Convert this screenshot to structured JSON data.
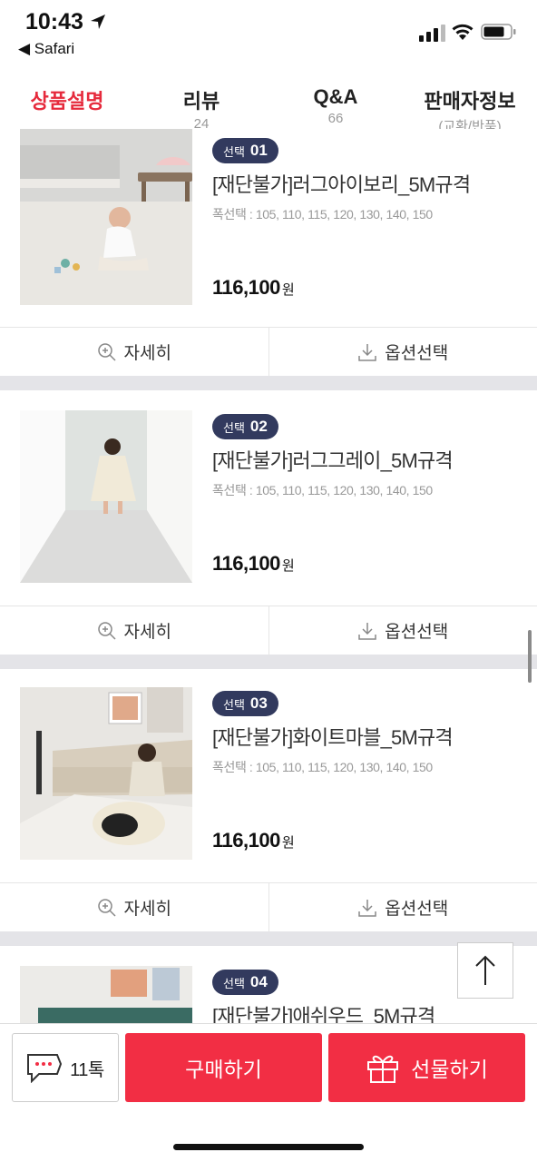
{
  "status_bar": {
    "time": "10:43",
    "back_app": "◀ Safari"
  },
  "tabs": [
    {
      "label": "상품설명",
      "sub": "",
      "active": true
    },
    {
      "label": "리뷰",
      "sub": "24",
      "active": false
    },
    {
      "label": "Q&A",
      "sub": "66",
      "active": false
    },
    {
      "label": "판매자정보",
      "sub": "(교환/반품)",
      "active": false
    }
  ],
  "products": [
    {
      "badge_prefix": "선택",
      "badge_num": "01",
      "name": "[재단불가]러그아이보리_5M규격",
      "options": "폭선택 : 105, 110, 115, 120, 130, 140, 150",
      "price": "116,100",
      "won": "원",
      "detail_label": "자세히",
      "option_label": "옵션선택"
    },
    {
      "badge_prefix": "선택",
      "badge_num": "02",
      "name": "[재단불가]러그그레이_5M규격",
      "options": "폭선택 : 105, 110, 115, 120, 130, 140, 150",
      "price": "116,100",
      "won": "원",
      "detail_label": "자세히",
      "option_label": "옵션선택"
    },
    {
      "badge_prefix": "선택",
      "badge_num": "03",
      "name": "[재단불가]화이트마블_5M규격",
      "options": "폭선택 : 105, 110, 115, 120, 130, 140, 150",
      "price": "116,100",
      "won": "원",
      "detail_label": "자세히",
      "option_label": "옵션선택"
    },
    {
      "badge_prefix": "선택",
      "badge_num": "04",
      "name": "[재단불가]애쉬우드_5M규격"
    }
  ],
  "bottom_bar": {
    "chat_label": "11톡",
    "buy_label": "구매하기",
    "gift_label": "선물하기"
  },
  "colors": {
    "accent": "#e62a3c",
    "button": "#f22e44",
    "badge": "#323a5e"
  }
}
